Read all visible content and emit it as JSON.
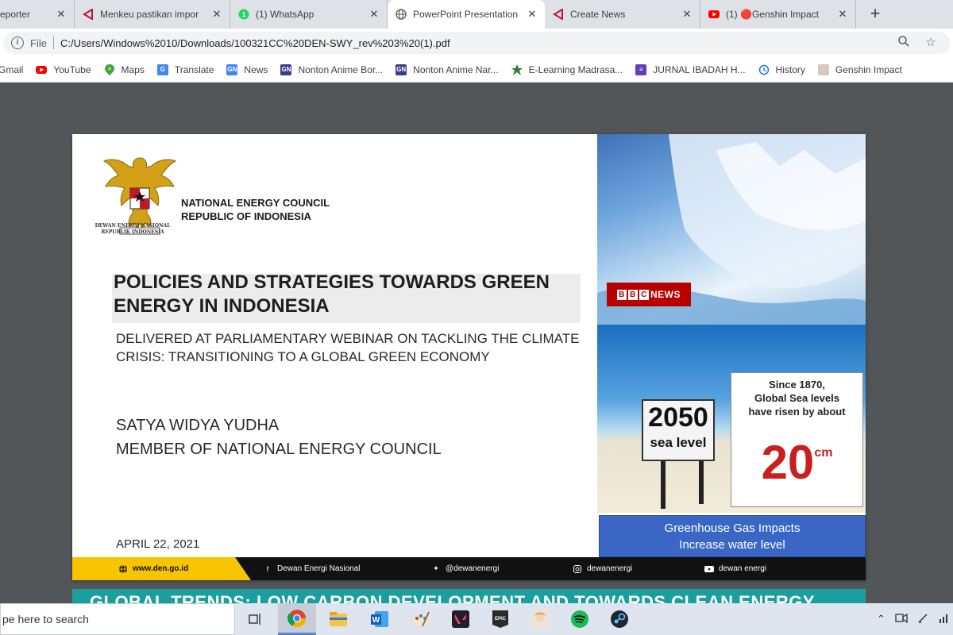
{
  "browser": {
    "tabs": [
      {
        "title": "eporter",
        "icon": "news-icon"
      },
      {
        "title": "Menkeu pastikan impor",
        "icon": "news-icon"
      },
      {
        "title": "(1) WhatsApp",
        "icon": "whatsapp-icon"
      },
      {
        "title": "PowerPoint Presentation",
        "icon": "globe-icon"
      },
      {
        "title": "Create News",
        "icon": "news-icon"
      },
      {
        "title": "(1) 🔴Genshin Impact",
        "icon": "youtube-icon"
      }
    ],
    "new_tab": "+",
    "address": {
      "scheme": "File",
      "url": "C:/Users/Windows%2010/Downloads/100321CC%20DEN-SWY_rev%203%20(1).pdf"
    },
    "bookmarks": [
      {
        "label": "Gmail",
        "icon": "gmail-icon"
      },
      {
        "label": "YouTube",
        "icon": "youtube-icon"
      },
      {
        "label": "Maps",
        "icon": "maps-icon"
      },
      {
        "label": "Translate",
        "icon": "translate-icon"
      },
      {
        "label": "News",
        "icon": "news-icon"
      },
      {
        "label": "Nonton Anime Bor...",
        "icon": "gn-icon"
      },
      {
        "label": "Nonton Anime Nar...",
        "icon": "gn-icon"
      },
      {
        "label": "E-Learning Madrasa...",
        "icon": "madrasah-icon"
      },
      {
        "label": "JURNAL IBADAH H...",
        "icon": "forms-icon"
      },
      {
        "label": "History",
        "icon": "history-icon"
      },
      {
        "label": "Genshin Impact",
        "icon": "genshin-icon"
      }
    ]
  },
  "slide": {
    "emblem_caption_line1": "DEWAN ENERGI NASIONAL",
    "emblem_caption_line2": "REPUBLIK INDONESIA",
    "council_line1": "NATIONAL ENERGY COUNCIL",
    "council_line2": "REPUBLIC OF INDONESIA",
    "title_line1": "POLICIES AND STRATEGIES TOWARDS GREEN",
    "title_line2": "ENERGY IN INDONESIA",
    "subtitle_line1": "DELIVERED AT PARLIAMENTARY WEBINAR ON TACKLING THE CLIMATE",
    "subtitle_line2": "CRISIS: TRANSITIONING TO A GLOBAL GREEN ECONOMY",
    "presenter_name": "SATYA WIDYA YUDHA",
    "presenter_role": "MEMBER OF NATIONAL ENERGY COUNCIL",
    "date": "APRIL 22, 2021",
    "footer": {
      "website": "www.den.go.id",
      "facebook": "Dewan Energi Nasional",
      "twitter": "@dewanenergi",
      "instagram": "dewanenergi",
      "youtube": "dewan energi"
    },
    "image_panel": {
      "bbc_logo_letters": [
        "B",
        "B",
        "C"
      ],
      "bbc_label": "NEWS",
      "sign_year": "2050",
      "sign_text": "sea level",
      "rise_line1": "Since 1870,",
      "rise_line2": "Global Sea levels",
      "rise_line3": "have risen by about",
      "rise_value": "20",
      "rise_unit": "cm",
      "impact_line1": "Greenhouse Gas Impacts",
      "impact_line2": "Increase water level"
    }
  },
  "next_slide_title": "GLOBAL TRENDS: LOW CARBON DEVELOPMENT AND TOWARDS CLEAN ENERGY",
  "taskbar": {
    "search_placeholder": "pe here to search",
    "apps": [
      "task-view-icon",
      "chrome-icon",
      "file-explorer-icon",
      "word-icon",
      "paint-icon",
      "valorant-icon",
      "epic-games-icon",
      "genshin-icon",
      "spotify-icon",
      "steam-icon"
    ]
  },
  "colors": {
    "accent_yellow": "#f6c500",
    "teal": "#1a9e9e",
    "bbc_red": "#b80000",
    "impact_blue": "#3a67c6",
    "rise_red": "#c9201f"
  }
}
